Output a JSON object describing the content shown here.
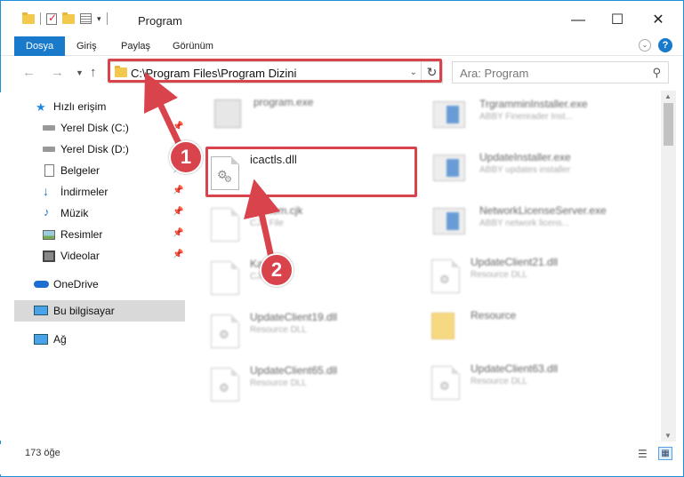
{
  "window": {
    "title": "Program"
  },
  "ribbon": {
    "tabs": [
      "Dosya",
      "Giriş",
      "Paylaş",
      "Görünüm"
    ]
  },
  "address": {
    "path": "C:\\Program Files\\Program Dizini"
  },
  "search": {
    "placeholder": "Ara: Program"
  },
  "sidebar": {
    "items": [
      {
        "label": "Hızlı erişim",
        "icon": "star-icon"
      },
      {
        "label": "Yerel Disk (C:)",
        "icon": "drive-icon"
      },
      {
        "label": "Yerel Disk (D:)",
        "icon": "drive-icon"
      },
      {
        "label": "Belgeler",
        "icon": "documents-icon"
      },
      {
        "label": "İndirmeler",
        "icon": "download-icon"
      },
      {
        "label": "Müzik",
        "icon": "music-icon"
      },
      {
        "label": "Resimler",
        "icon": "pictures-icon"
      },
      {
        "label": "Videolar",
        "icon": "videos-icon"
      },
      {
        "label": "OneDrive",
        "icon": "cloud-icon"
      },
      {
        "label": "Bu bilgisayar",
        "icon": "computer-icon"
      },
      {
        "label": "Ağ",
        "icon": "network-icon"
      }
    ]
  },
  "files": {
    "left": [
      {
        "name": "program.exe",
        "sub": ""
      },
      {
        "name": "icactls.dll",
        "sub": ""
      },
      {
        "name": "Custom.cjk",
        "sub": "CJK File"
      },
      {
        "name": "Kanji.cjk",
        "sub": "CJK File"
      },
      {
        "name": "UpdateClient19.dll",
        "sub": "Resource DLL"
      },
      {
        "name": "UpdateClient65.dll",
        "sub": "Resource DLL"
      }
    ],
    "right": [
      {
        "name": "TrgramminInstaller.exe",
        "sub": "ABBY Finereader Inst..."
      },
      {
        "name": "UpdateInstaller.exe",
        "sub": "ABBY updates installer"
      },
      {
        "name": "NetworkLicenseServer.exe",
        "sub": "ABBY network licens..."
      },
      {
        "name": "UpdateClient21.dll",
        "sub": "Resource DLL"
      },
      {
        "name": "Resource",
        "sub": ""
      },
      {
        "name": "UpdateClient63.dll",
        "sub": "Resource DLL"
      }
    ]
  },
  "badges": [
    "1",
    "2"
  ],
  "status": {
    "count": "173 öğe"
  },
  "colors": {
    "accent": "#1979ca",
    "highlight": "#d9434b"
  }
}
